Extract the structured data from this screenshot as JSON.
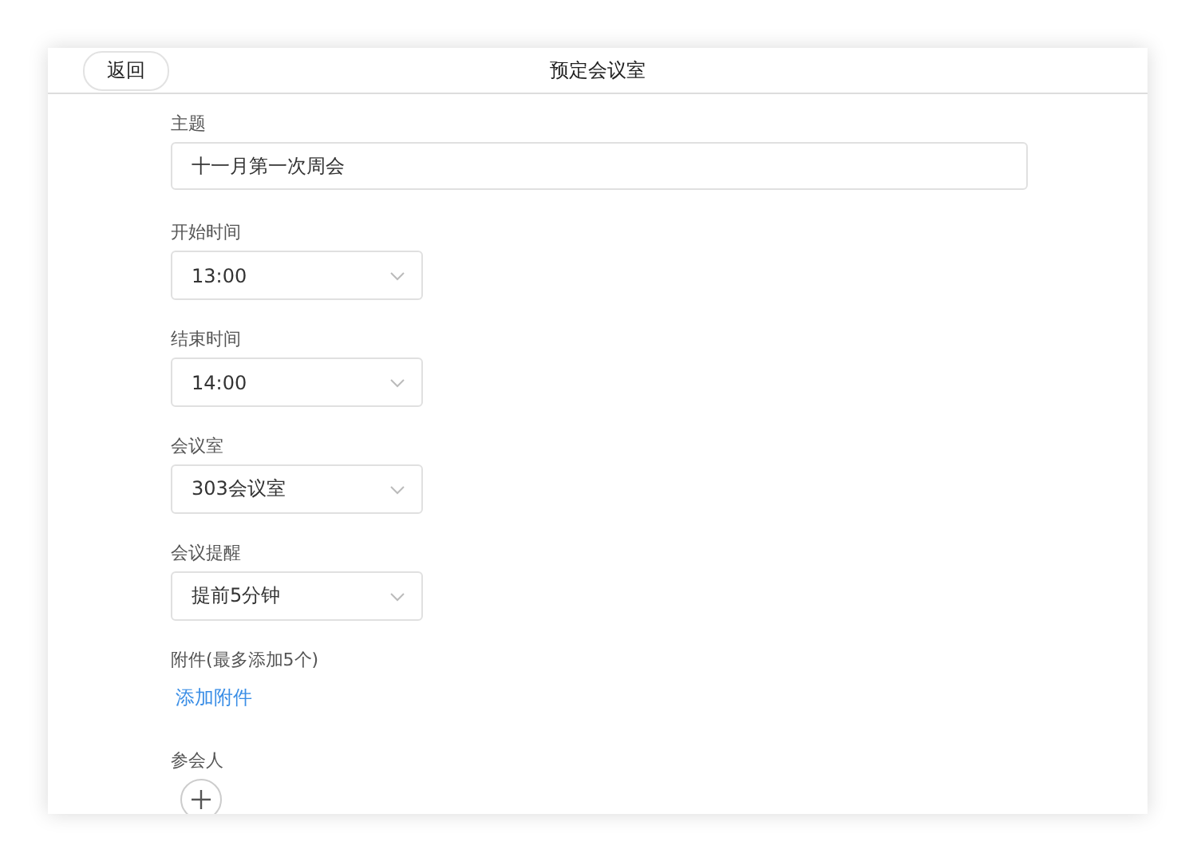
{
  "header": {
    "back_button": "返回",
    "title": "预定会议室"
  },
  "subject": {
    "label": "主题",
    "value": "十一月第一次周会"
  },
  "selects": [
    {
      "label": "开始时间",
      "value": "13:00"
    },
    {
      "label": "结束时间",
      "value": "14:00"
    },
    {
      "label": "会议室",
      "value": "303会议室"
    },
    {
      "label": "会议提醒",
      "value": "提前5分钟"
    }
  ],
  "attachments": {
    "label": "附件(最多添加5个)",
    "link": "添加附件"
  },
  "participants": {
    "label": "参会人"
  }
}
